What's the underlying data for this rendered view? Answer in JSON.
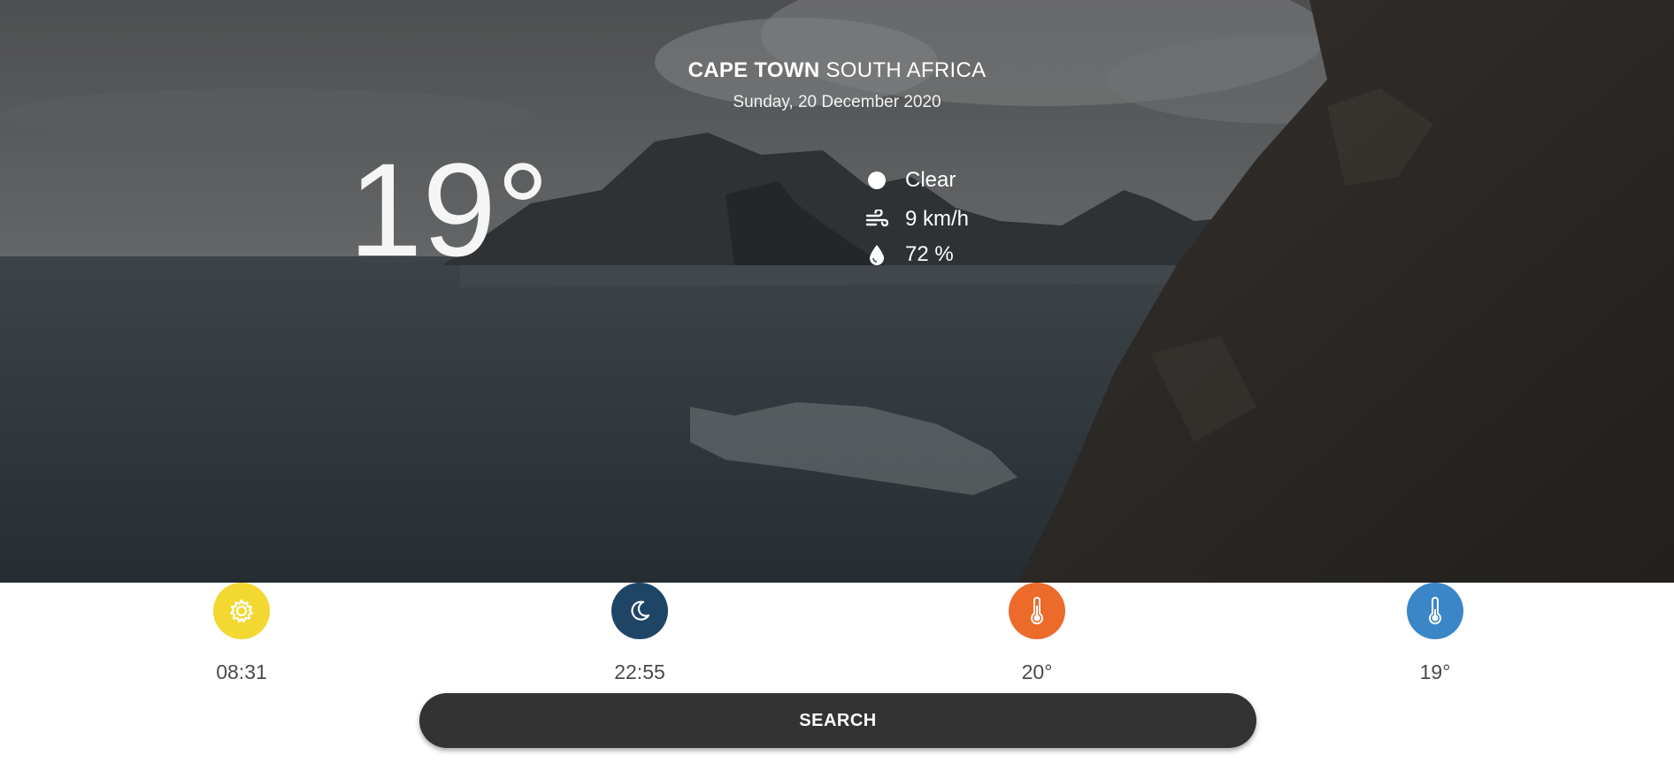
{
  "location": {
    "city": "CAPE TOWN",
    "country": "SOUTH AFRICA"
  },
  "date": "Sunday, 20 December 2020",
  "current": {
    "temperature": "19°",
    "condition": "Clear",
    "wind": "9 km/h",
    "humidity": "72 %",
    "icons": {
      "condition": "clear-moon-icon",
      "wind": "wind-icon",
      "humidity": "droplet-icon"
    }
  },
  "stats": [
    {
      "name": "sunrise",
      "icon": "sun-icon",
      "color": "#f3d831",
      "value": "08:31"
    },
    {
      "name": "sunset",
      "icon": "moon-icon",
      "color": "#1f4566",
      "value": "22:55"
    },
    {
      "name": "max-temp",
      "icon": "thermometer-icon",
      "color": "#ec6a2a",
      "value": "20°"
    },
    {
      "name": "min-temp",
      "icon": "thermometer-icon",
      "color": "#3b86c7",
      "value": "19°"
    }
  ],
  "search": {
    "label": "SEARCH"
  }
}
